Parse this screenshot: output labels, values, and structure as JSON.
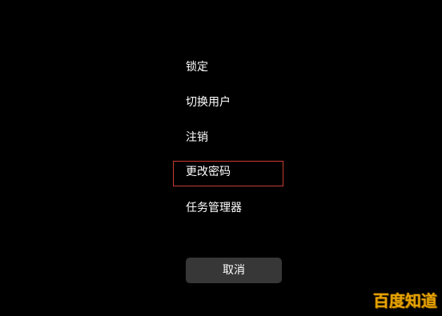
{
  "menu": {
    "items": [
      {
        "label": "锁定"
      },
      {
        "label": "切换用户"
      },
      {
        "label": "注销"
      },
      {
        "label": "更改密码"
      },
      {
        "label": "任务管理器"
      }
    ],
    "cancel_label": "取消"
  },
  "watermark": {
    "text": "百度知道"
  },
  "colors": {
    "background": "#000000",
    "text": "#ffffff",
    "focus_outline": "#c83c32",
    "cancel_button_bg": "#373737",
    "watermark": "#e8a400"
  }
}
